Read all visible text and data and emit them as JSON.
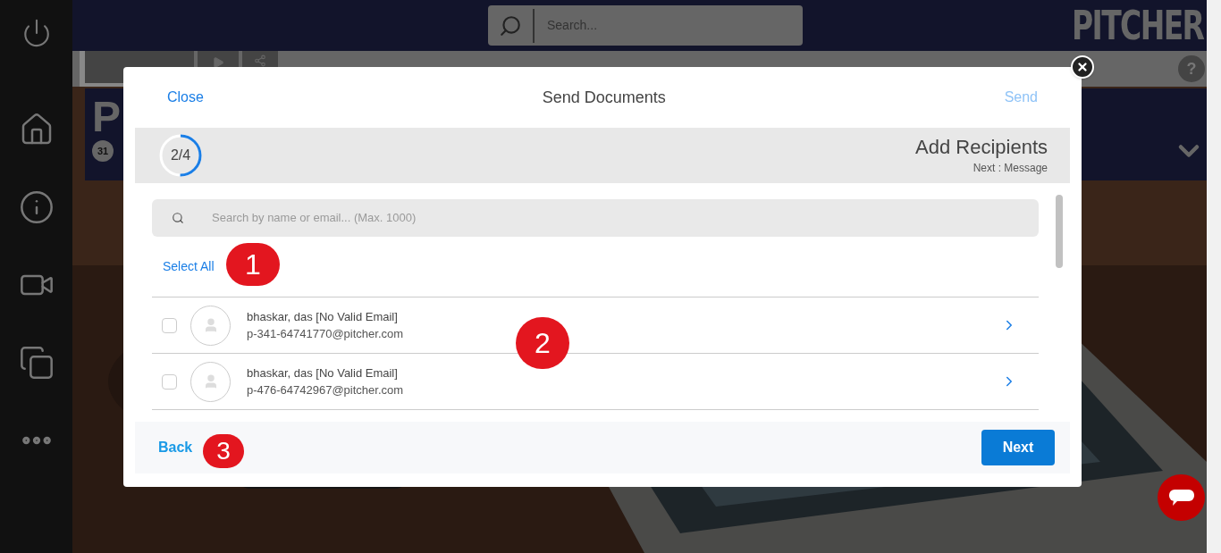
{
  "header": {
    "search": {
      "placeholder": "Search..."
    },
    "logo": "PITCHER"
  },
  "toolbar": {
    "help": "?"
  },
  "banner": {
    "title": "P",
    "badge": "31"
  },
  "dialog": {
    "close": "Close",
    "title": "Send Documents",
    "send": {
      "label": "Send",
      "disabled": true
    },
    "step": {
      "progress": "2/4",
      "level": 0.5,
      "title": "Add Recipients",
      "next": "Next : Message"
    },
    "search": {
      "placeholder": "Search by name or email... (Max. 1000)"
    },
    "select_all": "Select All",
    "contacts": [
      {
        "name": "bhaskar, das [No Valid Email]",
        "email": "p-341-64741770@pitcher.com",
        "checked": false
      },
      {
        "name": "bhaskar, das [No Valid Email]",
        "email": "p-476-64742967@pitcher.com",
        "checked": false
      }
    ],
    "back": "Back",
    "next": "Next"
  },
  "annotations": [
    "1",
    "2",
    "3"
  ]
}
